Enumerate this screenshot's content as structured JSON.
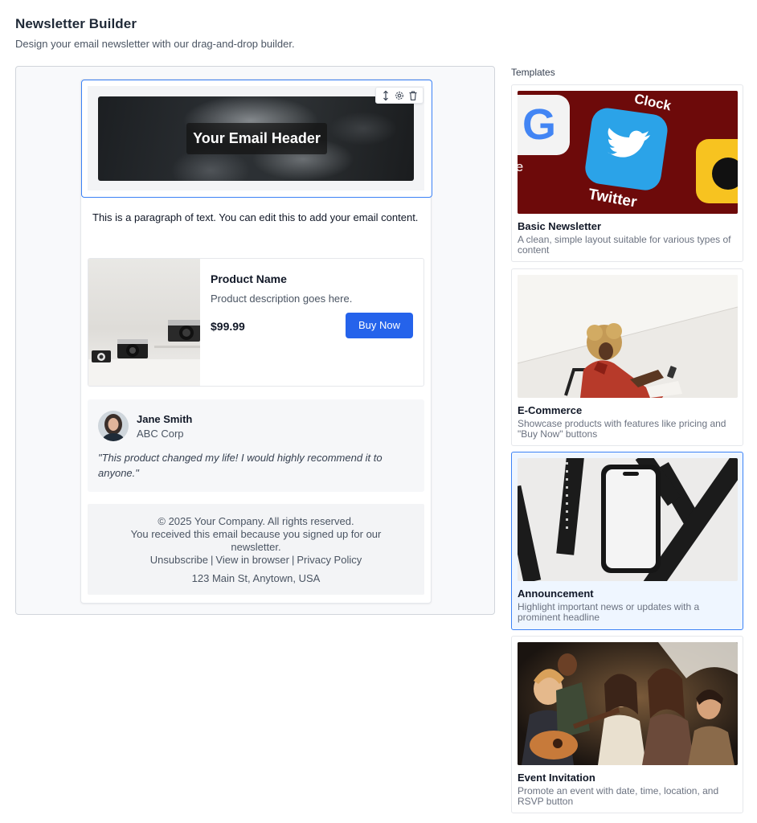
{
  "page": {
    "title": "Newsletter Builder",
    "subtitle": "Design your email newsletter with our drag-and-drop builder."
  },
  "email": {
    "header": {
      "title": "Your Email Header",
      "toolbar_icons": [
        "move-vertical-icon",
        "settings-icon",
        "trash-icon"
      ]
    },
    "paragraph": "This is a paragraph of text. You can edit this to add your email content.",
    "product": {
      "name": "Product Name",
      "description": "Product description goes here.",
      "price": "$99.99",
      "button_label": "Buy Now"
    },
    "testimonial": {
      "name": "Jane Smith",
      "company": "ABC Corp",
      "quote": "\"This product changed my life! I would highly recommend it to anyone.\""
    },
    "footer": {
      "copyright": "© 2025 Your Company. All rights reserved.",
      "notice": "You received this email because you signed up for our newsletter.",
      "links": [
        "Unsubscribe",
        "View in browser",
        "Privacy Policy"
      ],
      "address": "123 Main St, Anytown, USA"
    }
  },
  "templates": {
    "label": "Templates",
    "items": [
      {
        "name": "Basic Newsletter",
        "description": "A clean, simple layout suitable for various types of content",
        "selected": false
      },
      {
        "name": "E-Commerce",
        "description": "Showcase products with features like pricing and \"Buy Now\" buttons",
        "selected": false
      },
      {
        "name": "Announcement",
        "description": "Highlight important news or updates with a prominent headline",
        "selected": true
      },
      {
        "name": "Event Invitation",
        "description": "Promote an event with date, time, location, and RSVP button",
        "selected": false
      }
    ]
  },
  "colors": {
    "accent": "#2563eb",
    "selection": "#3b82f6",
    "selected_card_bg": "#eff6ff"
  }
}
